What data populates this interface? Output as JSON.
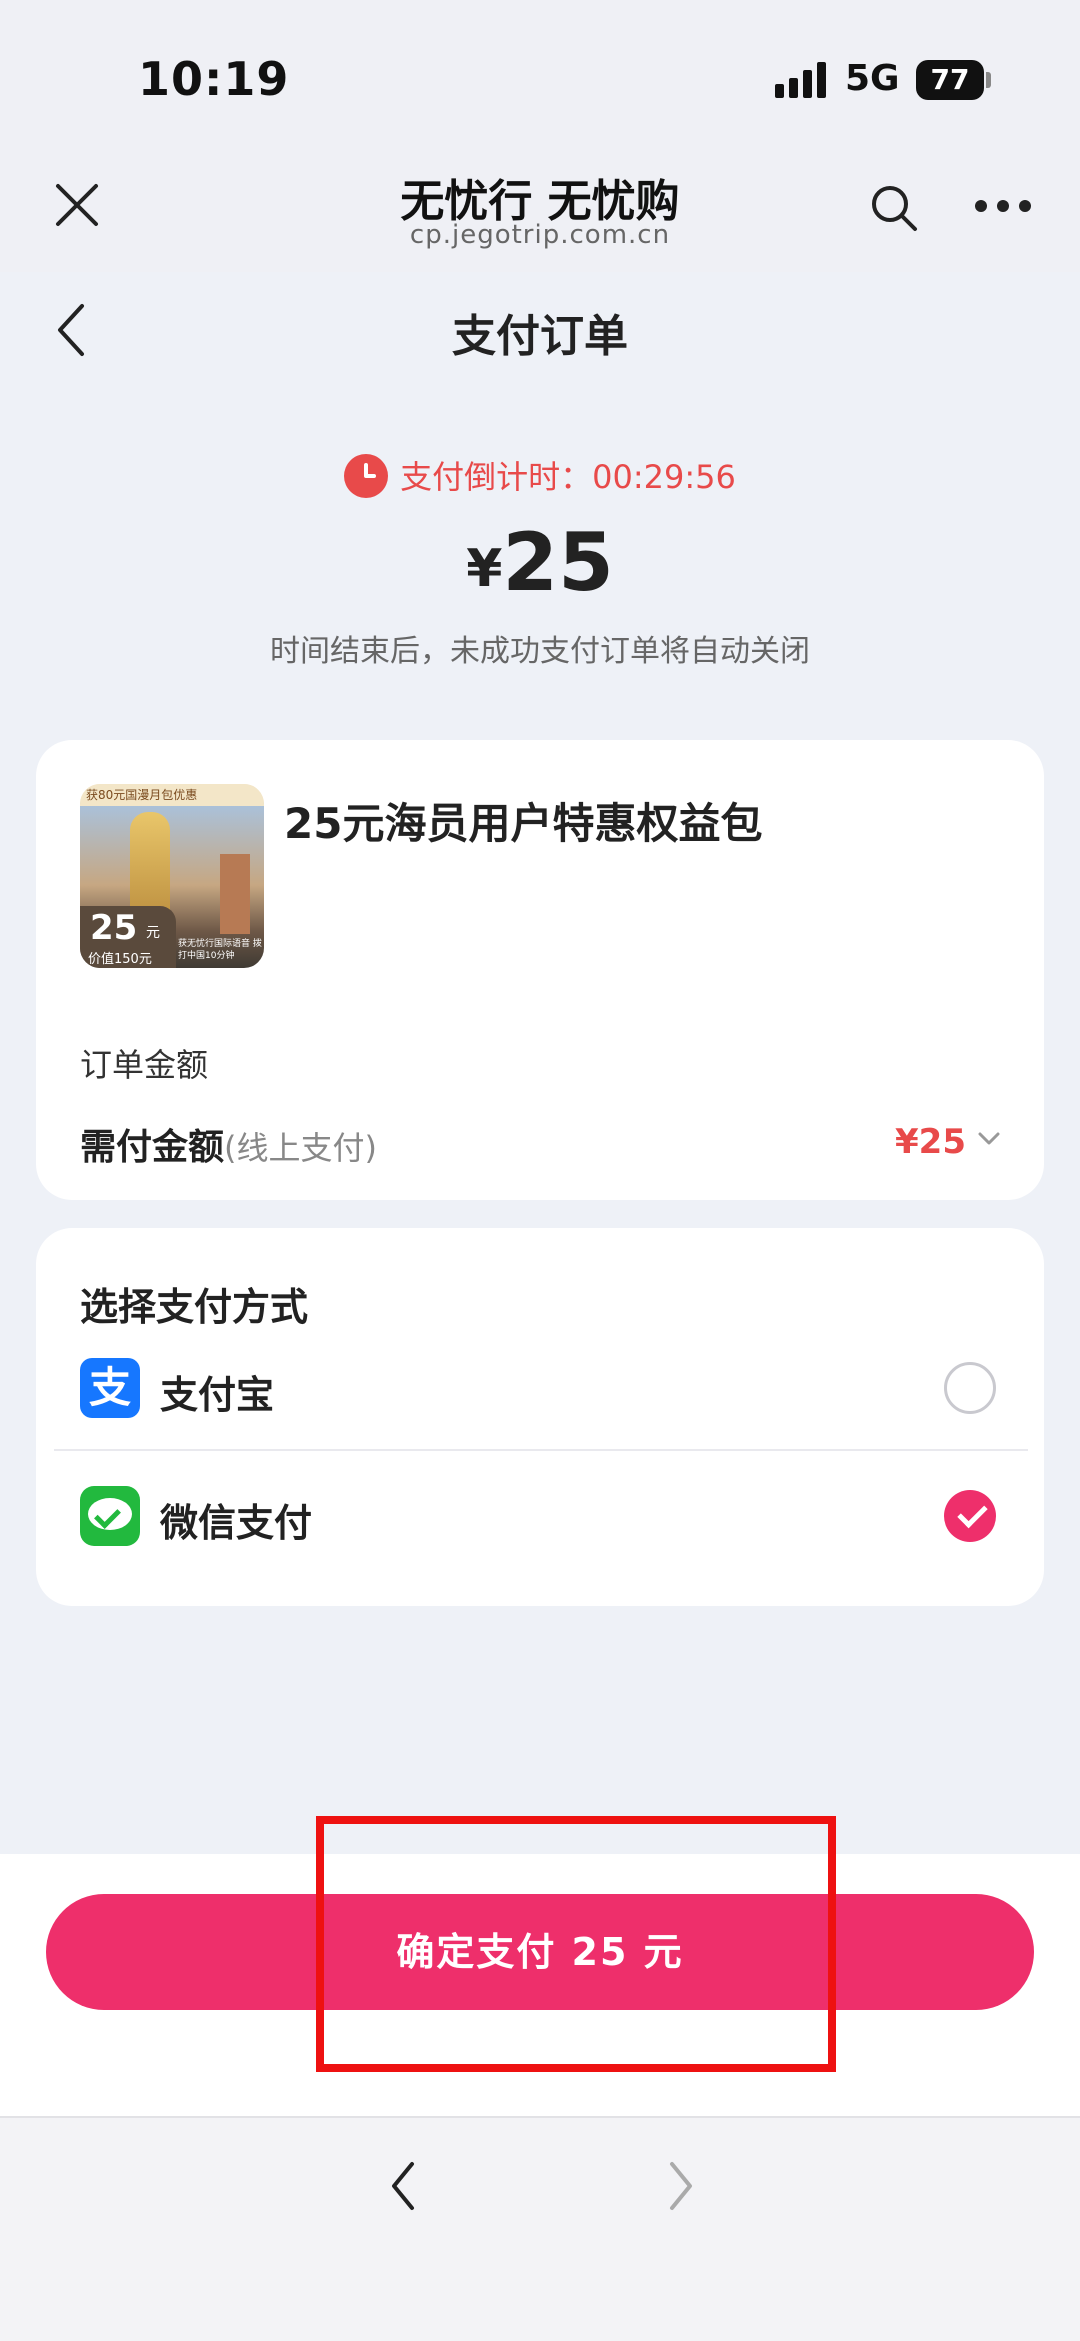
{
  "status_bar": {
    "time": "10:19",
    "network": "5G",
    "battery": "77"
  },
  "browser": {
    "title": "无忧行 无忧购",
    "url": "cp.jegotrip.com.cn"
  },
  "page": {
    "title": "支付订单"
  },
  "countdown": {
    "label": "支付倒计时：",
    "time": "00:29:56"
  },
  "price": {
    "currency": "¥",
    "amount": "25"
  },
  "close_hint": "时间结束后，未成功支付订单将自动关闭",
  "product": {
    "name": "25元海员用户特惠权益包",
    "image": {
      "banner": "获80元国漫月包优惠",
      "price": "25",
      "unit": "元",
      "worth": "价值150元",
      "note": "获无忧行国际语音 拨打中国10分钟"
    },
    "order_amount_label": "订单金额",
    "pay_label": "需付金额",
    "pay_note": "(线上支付)",
    "pay_amount": "¥25"
  },
  "payment": {
    "title": "选择支付方式",
    "methods": [
      {
        "label": "支付宝",
        "icon": "alipay-icon",
        "icon_glyph": "支",
        "selected": false
      },
      {
        "label": "微信支付",
        "icon": "wechat-pay-icon",
        "selected": true
      }
    ]
  },
  "confirm_button": "确定支付 25 元",
  "colors": {
    "accent": "#ee2f6b",
    "warning": "#e84a4a",
    "highlight": "#ee1111"
  }
}
